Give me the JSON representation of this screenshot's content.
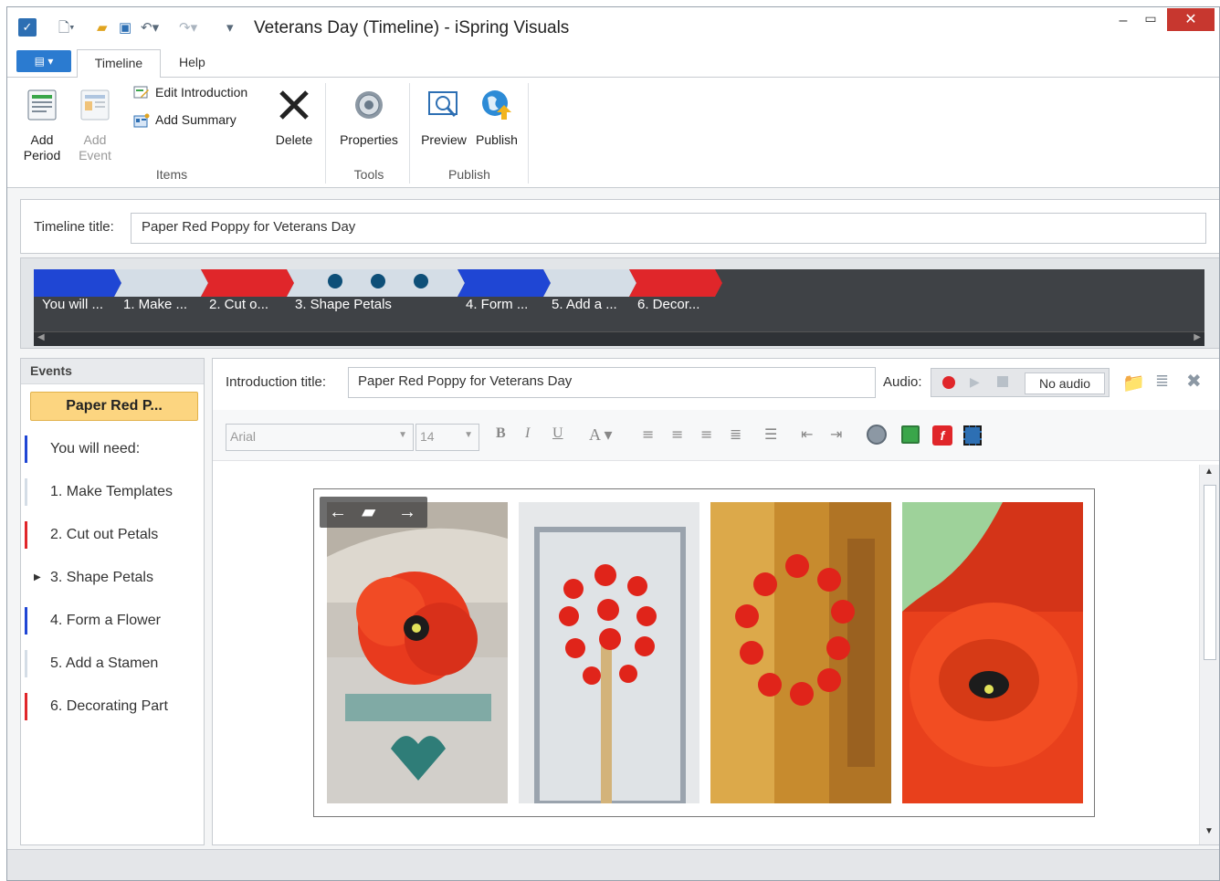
{
  "window": {
    "title": "Veterans Day (Timeline) - iSpring Visuals"
  },
  "ribbon": {
    "tabs": [
      {
        "label": "Timeline"
      },
      {
        "label": "Help"
      }
    ],
    "groups": {
      "items": "Items",
      "tools": "Tools",
      "publish": "Publish"
    },
    "buttons": {
      "add_period_1": "Add",
      "add_period_2": "Period",
      "add_event_1": "Add",
      "add_event_2": "Event",
      "edit_introduction": "Edit Introduction",
      "add_summary": "Add Summary",
      "delete": "Delete",
      "properties": "Properties",
      "preview": "Preview",
      "publish": "Publish"
    }
  },
  "timeline": {
    "title_label": "Timeline title:",
    "title_value": "Paper Red Poppy for Veterans Day",
    "segments": [
      {
        "label": "You will ...",
        "color": "#1f46d4"
      },
      {
        "label": "1. Make ...",
        "color": "#d4dde6"
      },
      {
        "label": "2. Cut o...",
        "color": "#e0262a"
      },
      {
        "label": "3. Shape Petals",
        "color": "#d4dde6"
      },
      {
        "label": "4. Form ...",
        "color": "#1f46d4"
      },
      {
        "label": "5. Add a ...",
        "color": "#d4dde6"
      },
      {
        "label": "6. Decor...",
        "color": "#e0262a"
      }
    ]
  },
  "events": {
    "header": "Events",
    "selected": "Paper Red P...",
    "items": [
      {
        "label": "You will need:",
        "color": "#1f46d4"
      },
      {
        "label": "1. Make Templates",
        "color": "#d4dde6"
      },
      {
        "label": "2. Cut out Petals",
        "color": "#e0262a"
      },
      {
        "label": "3. Shape Petals",
        "color": "#ffffff"
      },
      {
        "label": "4. Form a Flower",
        "color": "#1f46d4"
      },
      {
        "label": "5. Add a Stamen",
        "color": "#d4dde6"
      },
      {
        "label": "6. Decorating Part",
        "color": "#e0262a"
      }
    ]
  },
  "editor": {
    "intro_label": "Introduction title:",
    "intro_value": "Paper Red Poppy for Veterans Day",
    "audio_label": "Audio:",
    "audio_value": "No audio",
    "font": "Arial",
    "size": "14"
  }
}
